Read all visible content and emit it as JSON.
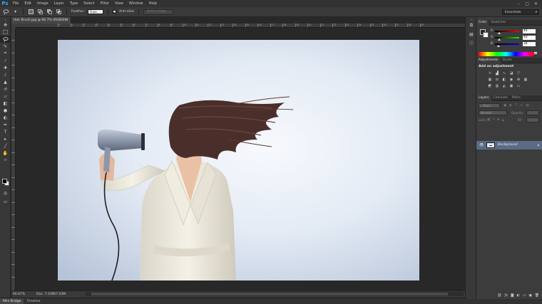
{
  "app": {
    "logo": "Ps"
  },
  "menu": [
    "File",
    "Edit",
    "Image",
    "Layer",
    "Type",
    "Select",
    "Filter",
    "View",
    "Window",
    "Help"
  ],
  "window_controls": [
    "–",
    "▢",
    "✕"
  ],
  "options": {
    "feather_label": "Feather:",
    "feather_value": "0 px",
    "antialias_label": "Anti-alias",
    "refine_button": "Refine Edge...",
    "workspace": "Essentials"
  },
  "document": {
    "tab_label": "Hair Brush.jpg @ 66.7% (RGB/8#)",
    "close": "×",
    "ruler_ticks": [
      "0",
      "1",
      "2",
      "3",
      "4",
      "5",
      "6",
      "7",
      "8",
      "9",
      "10",
      "11",
      "12",
      "13",
      "14",
      "15",
      "16",
      "17",
      "18",
      "19",
      "20",
      "21",
      "22",
      "23",
      "24",
      "25",
      "26",
      "27",
      "28",
      "29"
    ]
  },
  "status": {
    "zoom": "66.67%",
    "doc": "Doc: 7.03M/7.03M"
  },
  "bottom_tabs": [
    "Mini Bridge",
    "Timeline"
  ],
  "panels": {
    "color_tabs": [
      "Color",
      "Swatches"
    ],
    "color": {
      "channels": [
        {
          "label": "R",
          "value": "40"
        },
        {
          "label": "G",
          "value": "40"
        },
        {
          "label": "B",
          "value": "28"
        }
      ]
    },
    "adjust_tabs": [
      "Adjustments",
      "Styles"
    ],
    "adjust_title": "Add an adjustment",
    "layers_tabs": [
      "Layers",
      "Channels",
      "Paths"
    ],
    "layers": {
      "kind_label": "Kind",
      "blend_mode": "Normal",
      "opacity_label": "Opacity:",
      "opacity_value": "",
      "lock_label": "Lock:",
      "fill_label": "Fill:",
      "layer_name": "Background"
    }
  },
  "colors": {
    "accent": "#31a8ff",
    "layer_selected": "#5a6b86"
  }
}
